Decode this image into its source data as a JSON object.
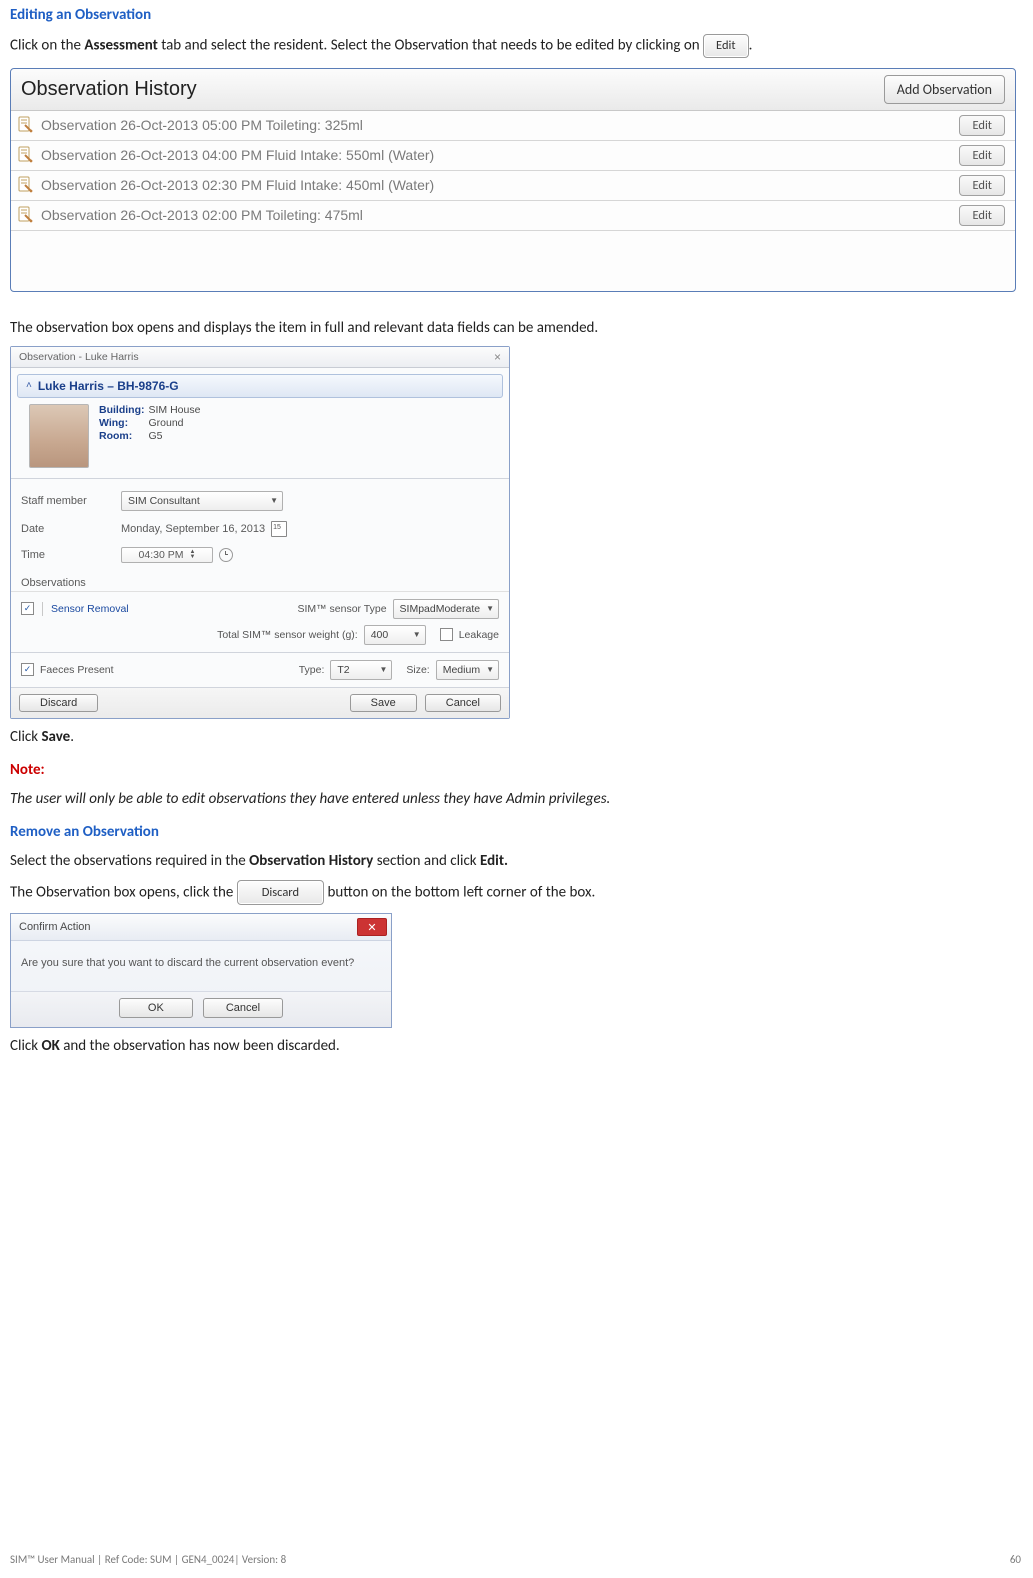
{
  "headings": {
    "editing": "Editing an Observation",
    "note": "Note",
    "remove": "Remove an Observation"
  },
  "para1": {
    "a": "Click on the ",
    "b": "Assessment",
    "c": " tab and select the resident. Select the Observation that needs to be edited by clicking on ",
    "d": "."
  },
  "para2": "The observation box opens and displays the item in full and relevant data fields can be amended.",
  "para3": {
    "a": "Click ",
    "b": "Save",
    "c": "."
  },
  "note_text": "The user will only be able to edit observations they have entered unless they have Admin privileges.",
  "para4": {
    "a": "Select the observations required in the ",
    "b": "Observation History",
    "c": " section and click ",
    "d": "Edit."
  },
  "para5": {
    "a": "The Observation box opens, click the ",
    "b": " button on the bottom left corner of the box."
  },
  "para6": {
    "a": "Click ",
    "b": "OK",
    "c": " and the observation has now been discarded."
  },
  "inline_buttons": {
    "edit": "Edit",
    "discard": "Discard"
  },
  "oh": {
    "title": "Observation History",
    "add": "Add Observation",
    "edit": "Edit",
    "rows": [
      "Observation  26-Oct-2013 05:00 PM Toileting: 325ml",
      "Observation  26-Oct-2013 04:00 PM Fluid Intake:  550ml (Water)",
      "Observation  26-Oct-2013 02:30 PM Fluid Intake:  450ml (Water)",
      "Observation  26-Oct-2013 02:00 PM Toileting: 475ml"
    ]
  },
  "ow": {
    "title": "Observation - Luke Harris",
    "resident_header": "Luke Harris  –  BH-9876-G",
    "loc": {
      "building_l": "Building:",
      "building_v": "SIM House",
      "wing_l": "Wing:",
      "wing_v": "Ground",
      "room_l": "Room:",
      "room_v": "G5"
    },
    "labels": {
      "staff": "Staff member",
      "date": "Date",
      "time": "Time",
      "obs": "Observations"
    },
    "staff_value": "SIM Consultant",
    "date_value": "Monday, September 16, 2013",
    "time_value": "04:30 PM",
    "sensor_removal": "Sensor Removal",
    "sensor_type_l": "SIM™ sensor Type",
    "sensor_type_v": "SIMpadModerate",
    "total_weight_l": "Total SIM™ sensor weight (g):",
    "total_weight_v": "400",
    "leakage": "Leakage",
    "faeces": "Faeces Present",
    "type_l": "Type:",
    "type_v": "T2",
    "size_l": "Size:",
    "size_v": "Medium",
    "buttons": {
      "discard": "Discard",
      "save": "Save",
      "cancel": "Cancel"
    }
  },
  "confirm": {
    "title": "Confirm Action",
    "body": "Are you sure that you want to discard the current observation event?",
    "ok": "OK",
    "cancel": "Cancel"
  },
  "footer": {
    "left": "SIM™ User Manual | Ref Code: SUM | GEN4_0024| Version: 8",
    "right": "60"
  }
}
